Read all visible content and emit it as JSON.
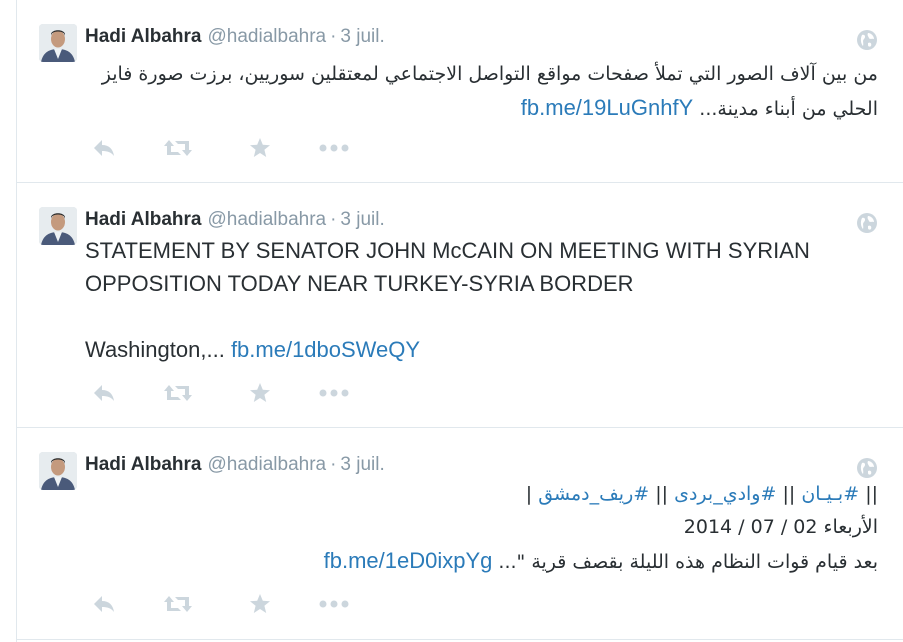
{
  "tweets": [
    {
      "fullname": "Hadi Albahra",
      "handle": "@hadialbahra",
      "separator": "·",
      "time": "3 juil.",
      "lines": [
        "من بين آلاف الصور التي تملأ صفحات مواقع التواصل الاجتماعي لمعتقلين سوريين، برزت صورة فايز",
        "الحلي من أبناء مدينة..."
      ],
      "link": "fb.me/19LuGnhfY"
    },
    {
      "fullname": "Hadi Albahra",
      "handle": "@hadialbahra",
      "separator": "·",
      "time": "3 juil.",
      "lines": [
        "STATEMENT BY SENATOR JOHN McCAIN ON MEETING WITH SYRIAN",
        "OPPOSITION TODAY NEAR TURKEY-SYRIA BORDER",
        "Washington,..."
      ],
      "link": "fb.me/1dboSWeQY"
    },
    {
      "fullname": "Hadi Albahra",
      "handle": "@hadialbahra",
      "separator": "·",
      "time": "3 juil.",
      "hashtags": [
        "#ريف_دمشق",
        "#وادي_بردى",
        "#بـيـان"
      ],
      "hashtag_sep": "||",
      "date_line": "الأربعاء 02 / 07 / 2014",
      "body_line": "بعد قيام قوات النظام هذه الليلة بقصف قرية \"...",
      "link": "fb.me/1eD0ixpYg"
    }
  ],
  "icons": {
    "reply": "reply-icon",
    "retweet": "retweet-icon",
    "favorite": "star-icon",
    "more": "more-icon",
    "globe": "globe-icon"
  },
  "colors": {
    "link": "#2b7bb9",
    "muted": "#8899a6",
    "text": "#292f33",
    "action_icon": "#ccd6dd"
  }
}
